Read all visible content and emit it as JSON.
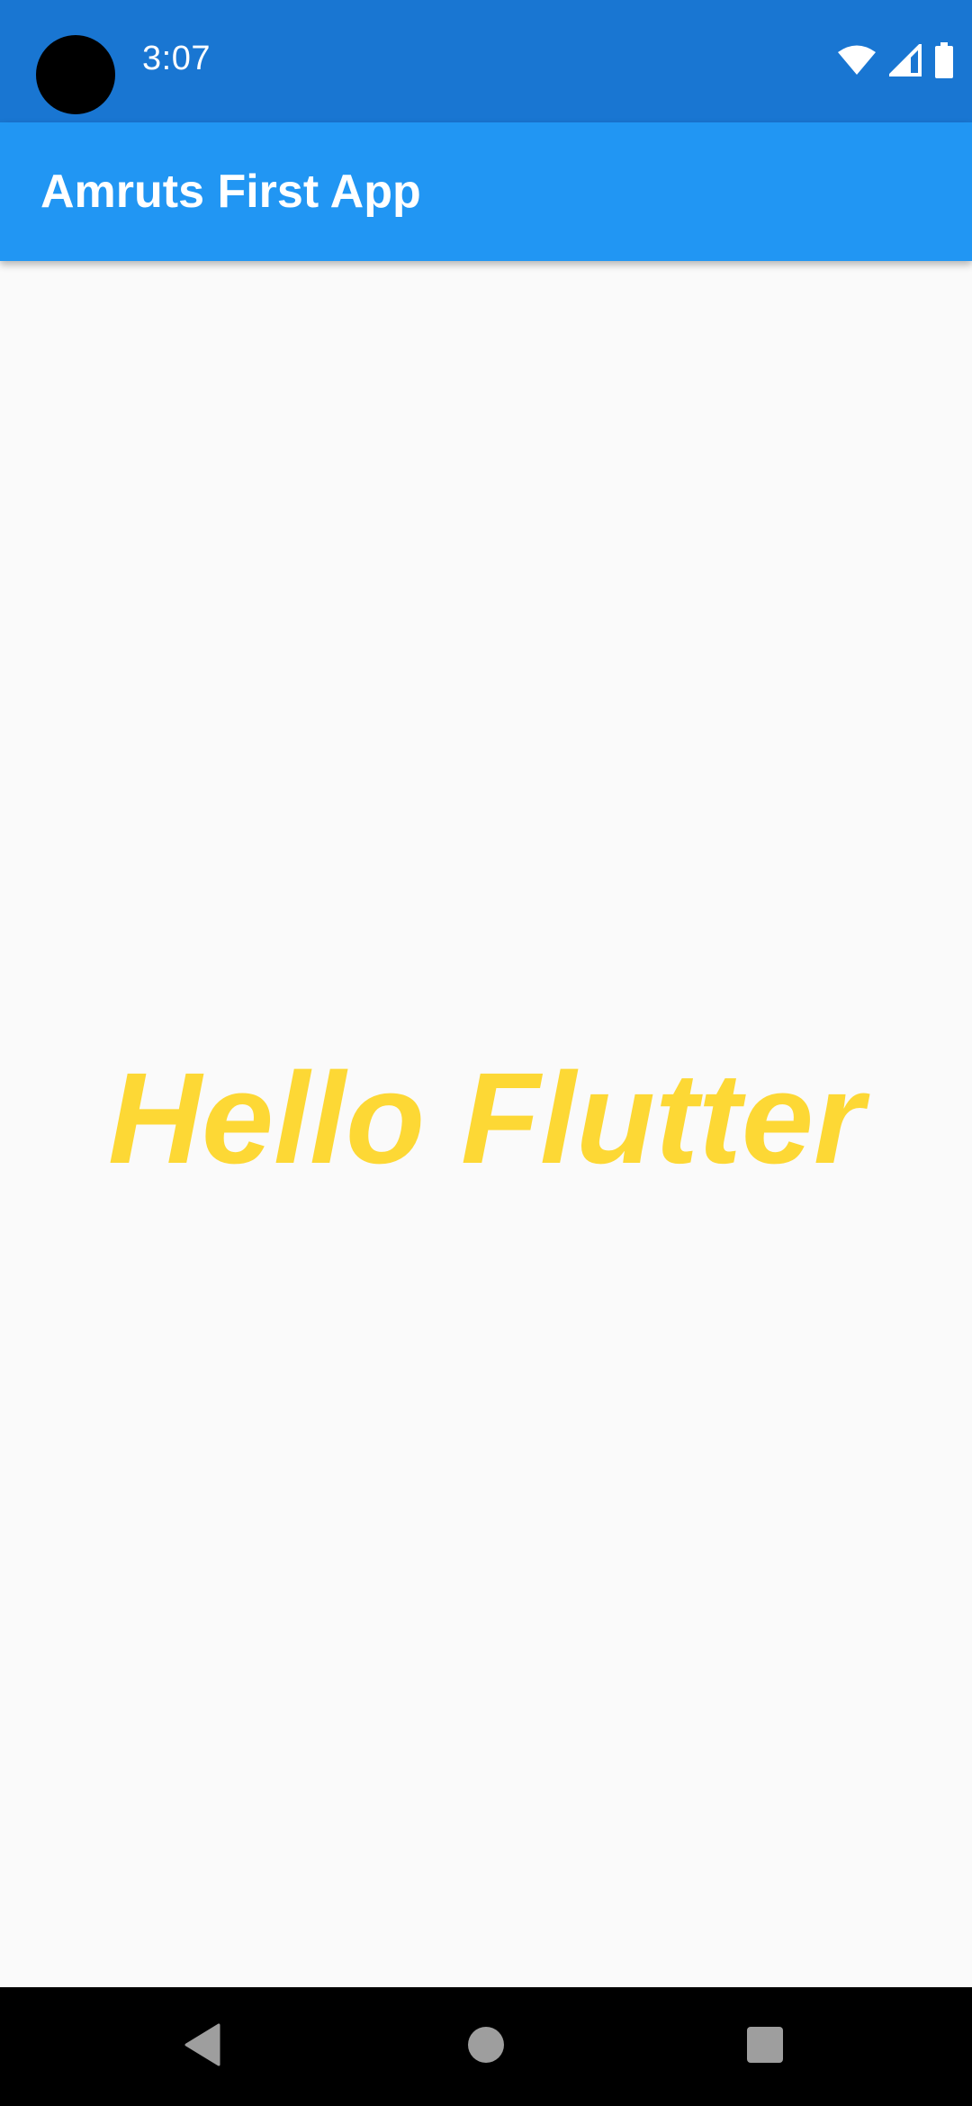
{
  "status_bar": {
    "time": "3:07",
    "icons": [
      "wifi-icon",
      "cell-signal-icon",
      "battery-icon"
    ],
    "background_color": "#1976d2"
  },
  "app_bar": {
    "title": "Amruts First App",
    "background_color": "#2196f3"
  },
  "body": {
    "text": "Hello Flutter",
    "text_color": "#fdd835"
  },
  "nav_bar": {
    "buttons": [
      "back-icon",
      "home-icon",
      "recents-icon"
    ]
  }
}
